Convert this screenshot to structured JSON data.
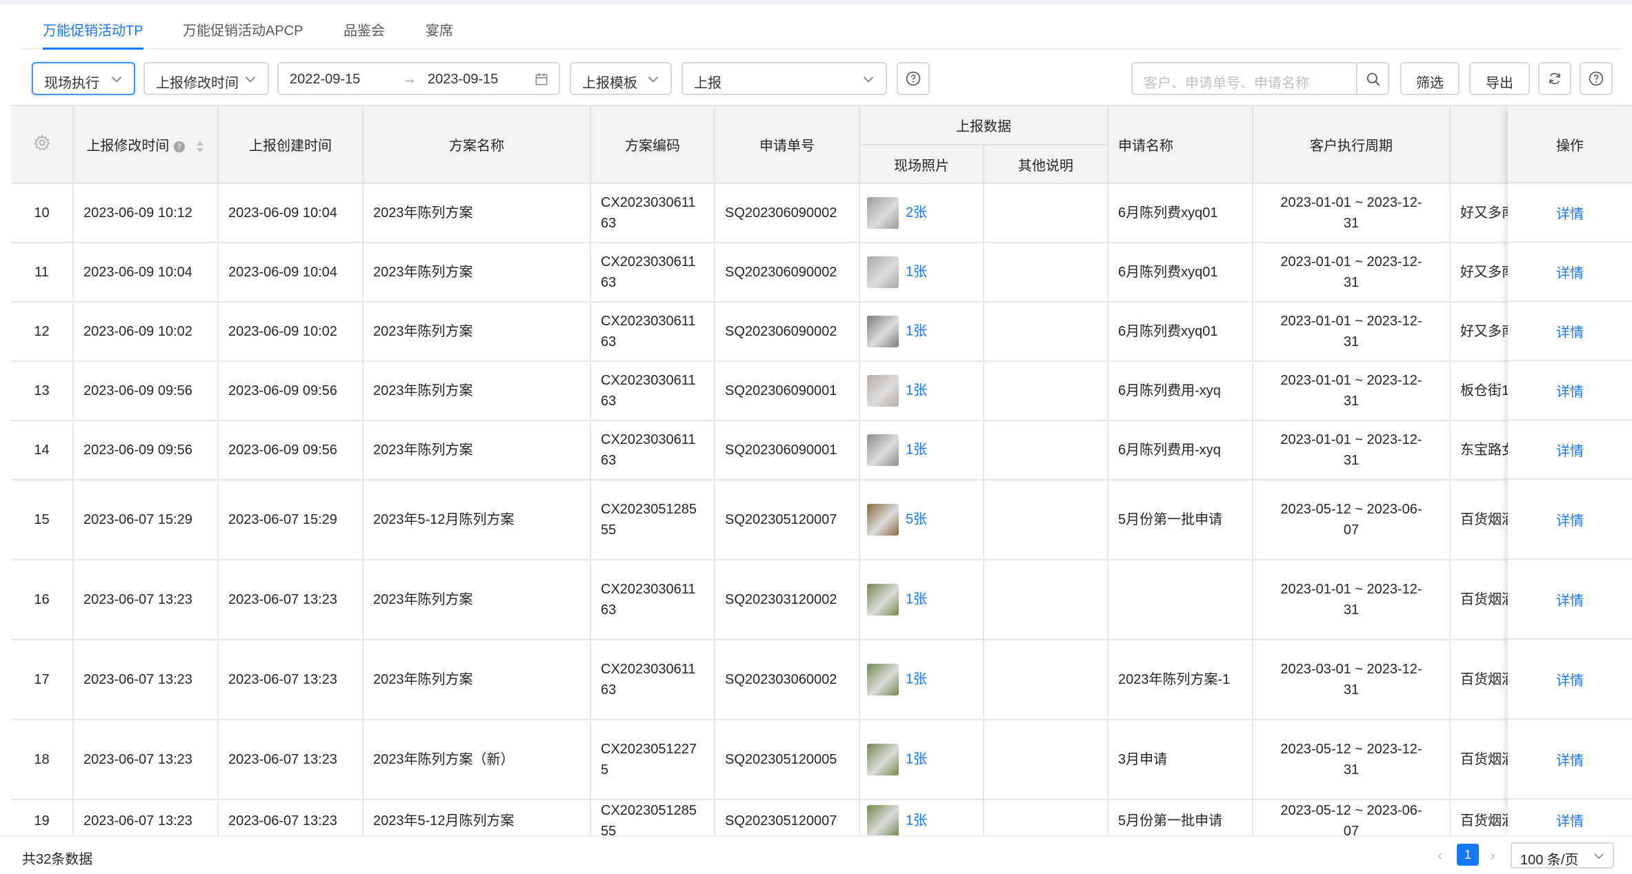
{
  "tabs": [
    {
      "label": "万能促销活动TP",
      "active": true
    },
    {
      "label": "万能促销活动APCP",
      "active": false
    },
    {
      "label": "品鉴会",
      "active": false
    },
    {
      "label": "宴席",
      "active": false
    }
  ],
  "toolbar": {
    "mode": "现场执行",
    "time_field": "上报修改时间",
    "date_start": "2022-09-15",
    "date_sep": "→",
    "date_end": "2023-09-15",
    "template": "上报模板",
    "report_status": "上报",
    "search_placeholder": "客户、申请单号、申请名称",
    "filter_label": "筛选",
    "export_label": "导出"
  },
  "table": {
    "headers": {
      "modify_time": "上报修改时间",
      "create_time": "上报创建时间",
      "plan_name": "方案名称",
      "plan_code": "方案编码",
      "apply_no": "申请单号",
      "report_group": "上报数据",
      "photos": "现场照片",
      "other": "其他说明",
      "apply_name": "申请名称",
      "period": "客户执行周期",
      "operation": "操作"
    },
    "rows": [
      {
        "idx": "10",
        "modify": "2023-06-09 10:12",
        "create": "2023-06-09 10:04",
        "plan": "2023年陈列方案",
        "code1": "CX2023030611",
        "code2": "63",
        "apply_no": "SQ202306090002",
        "photo_count": "2张",
        "photo_color": "#9a9a9a",
        "other": "",
        "apply_name": "6月陈列费xyq01",
        "period1": "2023-01-01 ~ 2023-12-",
        "period2": "31",
        "customer": "好又多南",
        "op": "详情"
      },
      {
        "idx": "11",
        "modify": "2023-06-09 10:04",
        "create": "2023-06-09 10:04",
        "plan": "2023年陈列方案",
        "code1": "CX2023030611",
        "code2": "63",
        "apply_no": "SQ202306090002",
        "photo_count": "1张",
        "photo_color": "#a8a8a8",
        "other": "",
        "apply_name": "6月陈列费xyq01",
        "period1": "2023-01-01 ~ 2023-12-",
        "period2": "31",
        "customer": "好又多南",
        "op": "详情"
      },
      {
        "idx": "12",
        "modify": "2023-06-09 10:02",
        "create": "2023-06-09 10:02",
        "plan": "2023年陈列方案",
        "code1": "CX2023030611",
        "code2": "63",
        "apply_no": "SQ202306090002",
        "photo_count": "1张",
        "photo_color": "#7d7d7d",
        "other": "",
        "apply_name": "6月陈列费xyq01",
        "period1": "2023-01-01 ~ 2023-12-",
        "period2": "31",
        "customer": "好又多南",
        "op": "详情"
      },
      {
        "idx": "13",
        "modify": "2023-06-09 09:56",
        "create": "2023-06-09 09:56",
        "plan": "2023年陈列方案",
        "code1": "CX2023030611",
        "code2": "63",
        "apply_no": "SQ202306090001",
        "photo_count": "1张",
        "photo_color": "#b9aea4",
        "other": "",
        "apply_name": "6月陈列费用-xyq",
        "period1": "2023-01-01 ~ 2023-12-",
        "period2": "31",
        "customer": "板仓街1",
        "op": "详情"
      },
      {
        "idx": "14",
        "modify": "2023-06-09 09:56",
        "create": "2023-06-09 09:56",
        "plan": "2023年陈列方案",
        "code1": "CX2023030611",
        "code2": "63",
        "apply_no": "SQ202306090001",
        "photo_count": "1张",
        "photo_color": "#8f8c88",
        "other": "",
        "apply_name": "6月陈列费用-xyq",
        "period1": "2023-01-01 ~ 2023-12-",
        "period2": "31",
        "customer": "东宝路女",
        "op": "详情"
      },
      {
        "idx": "15",
        "modify": "2023-06-07 15:29",
        "create": "2023-06-07 15:29",
        "plan": "2023年5-12月陈列方案",
        "code1": "CX2023051285",
        "code2": "55",
        "apply_no": "SQ202305120007",
        "photo_count": "5张",
        "photo_color": "#8a6a3c",
        "other": "",
        "apply_name": "5月份第一批申请",
        "period1": "2023-05-12 ~ 2023-06-",
        "period2": "07",
        "customer": "百货烟酒",
        "op": "详情"
      },
      {
        "idx": "16",
        "modify": "2023-06-07 13:23",
        "create": "2023-06-07 13:23",
        "plan": "2023年陈列方案",
        "code1": "CX2023030611",
        "code2": "63",
        "apply_no": "SQ202303120002",
        "photo_count": "1张",
        "photo_color": "#6f8a4a",
        "other": "",
        "apply_name": "",
        "period1": "2023-01-01 ~ 2023-12-",
        "period2": "31",
        "customer": "百货烟酒",
        "op": "详情"
      },
      {
        "idx": "17",
        "modify": "2023-06-07 13:23",
        "create": "2023-06-07 13:23",
        "plan": "2023年陈列方案",
        "code1": "CX2023030611",
        "code2": "63",
        "apply_no": "SQ202303060002",
        "photo_count": "1张",
        "photo_color": "#6f8a4a",
        "other": "",
        "apply_name": "2023年陈列方案-1",
        "period1": "2023-03-01 ~ 2023-12-",
        "period2": "31",
        "customer": "百货烟酒",
        "op": "详情"
      },
      {
        "idx": "18",
        "modify": "2023-06-07 13:23",
        "create": "2023-06-07 13:23",
        "plan": "2023年陈列方案（新）",
        "code1": "CX2023051227",
        "code2": "5",
        "apply_no": "SQ202305120005",
        "photo_count": "1张",
        "photo_color": "#6f8a4a",
        "other": "",
        "apply_name": "3月申请",
        "period1": "2023-05-12 ~ 2023-12-",
        "period2": "31",
        "customer": "百货烟酒",
        "op": "详情"
      },
      {
        "idx": "19",
        "modify": "2023-06-07 13:23",
        "create": "2023-06-07 13:23",
        "plan": "2023年5-12月陈列方案",
        "code1": "CX2023051285",
        "code2": "55",
        "apply_no": "SQ202305120007",
        "photo_count": "1张",
        "photo_color": "#6f8a4a",
        "other": "",
        "apply_name": "5月份第一批申请",
        "period1": "2023-05-12 ~ 2023-06-",
        "period2": "07",
        "customer": "百货烟酒",
        "op": "详情"
      }
    ]
  },
  "footer": {
    "total": "共32条数据",
    "current_page": "1",
    "page_size": "100 条/页"
  },
  "colors": {
    "accent": "#1677ff",
    "header_bg": "#f2f3f5"
  }
}
